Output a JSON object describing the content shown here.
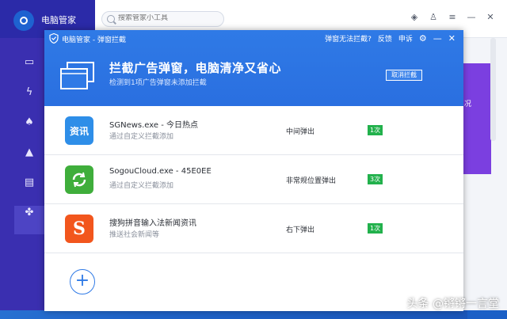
{
  "main_app": {
    "title": "电脑管家",
    "search": {
      "placeholder": "搜索管家小工具"
    },
    "top_icons": [
      "skin-icon",
      "shirt-icon",
      "menu-icon",
      "minimize-icon",
      "close-icon"
    ],
    "sidebar_icons": [
      "monitor-icon",
      "flash-icon",
      "broom-icon",
      "rocket-icon",
      "toolbox-icon",
      "apps-icon"
    ],
    "right_panel_text": "况"
  },
  "dialog": {
    "title": "电脑管家 - 弹窗拦截",
    "links": {
      "cant_block": "弹窗无法拦截?",
      "feedback": "反馈",
      "praise": "申诉"
    },
    "banner": {
      "title": "拦截广告弹窗，电脑清净又省心",
      "subtitle": "检测到1项广告弹窗未添加拦截",
      "cancel_label": "取消拦截"
    },
    "items": [
      {
        "name": "SGNews.exe - 今日热点",
        "desc": "通过自定义拦截添加",
        "mode": "中间弹出",
        "count": "1次",
        "icon": "news-icon",
        "icon_text": "资讯",
        "icon_color": "#2e8ee8"
      },
      {
        "name": "SogouCloud.exe - 45E0EE",
        "desc": "通过自定义拦截添加",
        "mode": "非常规位置弹出",
        "count": "3次",
        "icon": "sync-icon",
        "icon_text": "",
        "icon_color": "#3fae3b"
      },
      {
        "name": "搜狗拼音输入法新闻资讯",
        "desc": "推送社会新闻等",
        "mode": "右下弹出",
        "count": "1次",
        "icon": "sogou-icon",
        "icon_text": "S",
        "icon_color": "#f2561d"
      }
    ],
    "add_label": "+"
  },
  "watermark": "头条 @锵锵一言堂",
  "colors": {
    "accent": "#2f7ae6",
    "badge": "#22b14c",
    "sidebar": "#3a2fb0"
  }
}
